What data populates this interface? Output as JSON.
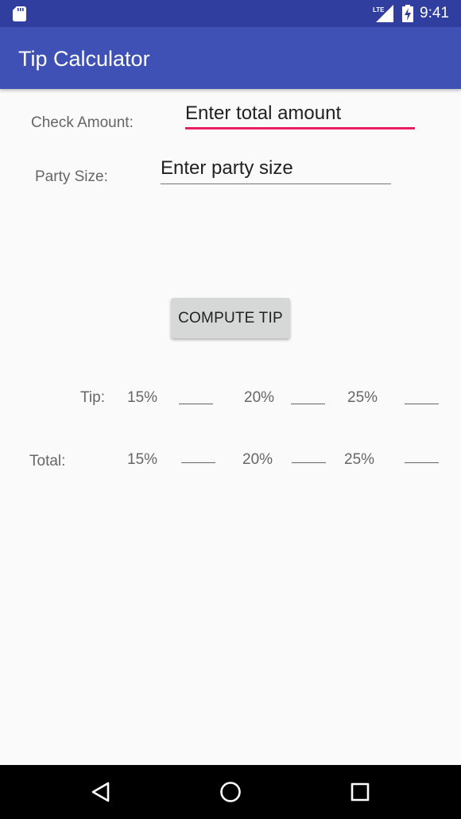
{
  "status_bar": {
    "time": "9:41",
    "icons": [
      "sd-card-icon",
      "lte-signal-icon",
      "battery-charging-icon"
    ]
  },
  "app_bar": {
    "title": "Tip Calculator"
  },
  "form": {
    "check_amount_label": "Check Amount:",
    "check_amount_placeholder": "Enter total amount",
    "party_size_label": "Party Size:",
    "party_size_placeholder": "Enter party size"
  },
  "compute_button": {
    "label": "COMPUTE TIP"
  },
  "results": {
    "tip_label": "Tip:",
    "total_label": "Total:",
    "percentages": [
      "15%",
      "20%",
      "25%"
    ],
    "tip_values": [
      "",
      "",
      ""
    ],
    "total_values": [
      "",
      "",
      ""
    ]
  },
  "nav_bar": {
    "icons": [
      "back-icon",
      "home-icon",
      "recents-icon"
    ]
  },
  "colors": {
    "status_bar": "#303f9f",
    "app_bar": "#3f51b5",
    "focus_accent": "#e91e63",
    "background": "#fafafa"
  }
}
